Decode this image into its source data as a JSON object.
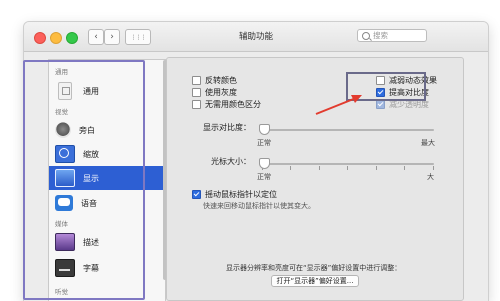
{
  "window": {
    "title": "辅助功能"
  },
  "toolbar": {
    "back_glyph": "‹",
    "forward_glyph": "›",
    "grid_glyph": "⋮⋮⋮",
    "search_placeholder": "搜索"
  },
  "sidebar": {
    "sections": [
      {
        "label": "通用"
      },
      {
        "label": "视觉"
      },
      {
        "label": "媒体"
      },
      {
        "label": "听觉"
      }
    ],
    "items": [
      {
        "label": "通用",
        "icon": "general-icon"
      },
      {
        "label": "旁白",
        "icon": "voiceover-icon"
      },
      {
        "label": "缩放",
        "icon": "zoom-icon"
      },
      {
        "label": "显示",
        "icon": "display-icon",
        "selected": true
      },
      {
        "label": "语音",
        "icon": "speech-icon"
      },
      {
        "label": "描述",
        "icon": "descriptions-icon"
      },
      {
        "label": "字幕",
        "icon": "captions-icon"
      }
    ]
  },
  "display": {
    "options_left": [
      {
        "label": "反转颜色",
        "checked": false
      },
      {
        "label": "使用灰度",
        "checked": false
      },
      {
        "label": "无需用颜色区分",
        "checked": false
      }
    ],
    "options_right": [
      {
        "label": "减弱动态效果",
        "checked": false
      },
      {
        "label": "提高对比度",
        "checked": true
      },
      {
        "label": "减少透明度",
        "checked": true,
        "disabled": true
      }
    ],
    "contrast": {
      "label": "显示对比度：",
      "min_label": "正常",
      "max_label": "最大",
      "value": 0
    },
    "cursor": {
      "label": "光标大小：",
      "min_label": "正常",
      "max_label": "大",
      "value": 0
    },
    "shake": {
      "label": "摇动鼠标指针以定位",
      "checked": true,
      "description": "快速来回移动鼠标指针以使其变大。"
    },
    "footer_hint": "显示器分辨率和亮度可在“显示器”偏好设置中进行调整：",
    "open_button": "打开“显示器”偏好设置..."
  },
  "colors": {
    "accent": "#2d5fd3",
    "checkbox_blue": "#2d6cdf",
    "arrow_red": "#e23b2e",
    "outline_purple": "#7f78c2"
  }
}
